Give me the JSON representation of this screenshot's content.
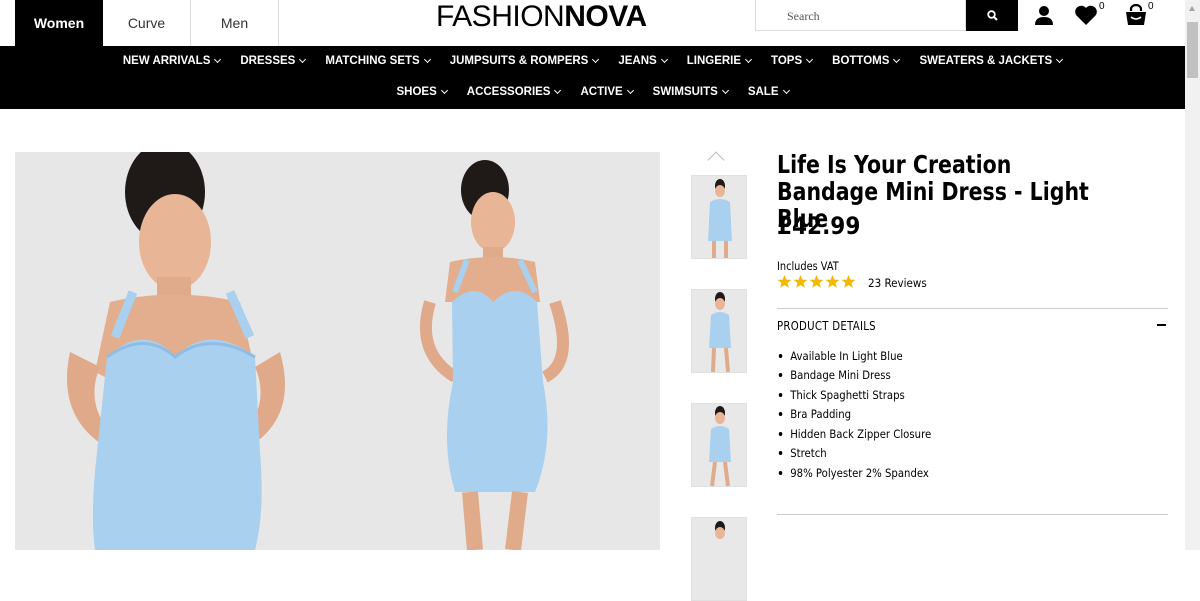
{
  "gender_tabs": [
    {
      "label": "Women",
      "active": true
    },
    {
      "label": "Curve",
      "active": false
    },
    {
      "label": "Men",
      "active": false
    }
  ],
  "logo": {
    "thin": "FASHION",
    "bold": "NOVA"
  },
  "search": {
    "placeholder": "Search",
    "icon": "search-icon"
  },
  "header_icons": {
    "account": "user-icon",
    "wishlist": "heart-icon",
    "wishlist_count": "0",
    "cart": "bag-icon",
    "cart_count": "0"
  },
  "nav": {
    "row1": [
      "NEW ARRIVALS",
      "DRESSES",
      "MATCHING SETS",
      "JUMPSUITS & ROMPERS",
      "JEANS",
      "LINGERIE",
      "TOPS",
      "BOTTOMS",
      "SWEATERS & JACKETS"
    ],
    "row2": [
      "SHOES",
      "ACCESSORIES",
      "ACTIVE",
      "SWIMSUITS",
      "SALE"
    ]
  },
  "product": {
    "title": "Life Is Your Creation Bandage Mini Dress - Light Blue",
    "price": "£42.99",
    "vat": "Includes VAT",
    "rating": 5,
    "reviews": "23 Reviews",
    "details_heading": "PRODUCT DETAILS",
    "details": [
      "Available In Light Blue",
      "Bandage Mini Dress",
      "Thick Spaghetti Straps",
      "Bra Padding",
      "Hidden Back Zipper Closure",
      "Stretch",
      "98% Polyester 2% Spandex"
    ]
  },
  "colors": {
    "dress": "#a9d0ef",
    "star": "#f5b800",
    "nav_bg": "#000000",
    "image_bg": "#e7e7e7"
  }
}
